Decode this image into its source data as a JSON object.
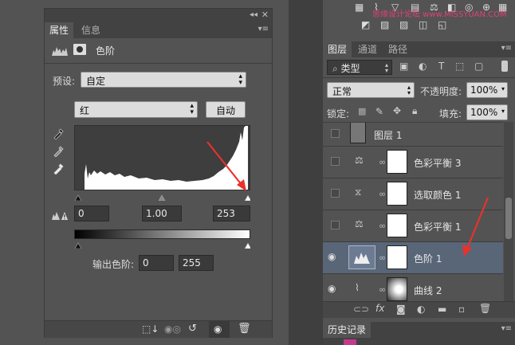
{
  "properties": {
    "tabs": [
      {
        "label": "属性"
      },
      {
        "label": "信息"
      }
    ],
    "adjustment_title": "色阶",
    "preset_label": "预设:",
    "preset_value": "自定",
    "channel_value": "红",
    "auto_label": "自动",
    "input_levels": {
      "black": "0",
      "mid": "1.00",
      "white": "253"
    },
    "output_label": "输出色阶:",
    "output_levels": {
      "black": "0",
      "white": "255"
    }
  },
  "layers_panel": {
    "tabs": [
      {
        "label": "图层"
      },
      {
        "label": "通道"
      },
      {
        "label": "路径"
      }
    ],
    "filter_label": "类型",
    "blend_mode": "正常",
    "opacity_label": "不透明度:",
    "opacity_value": "100%",
    "lock_label": "锁定:",
    "fill_label": "填充:",
    "fill_value": "100%",
    "layers": [
      {
        "name": "图层 1",
        "type": "pixel",
        "visible": false
      },
      {
        "name": "色彩平衡 3",
        "type": "color-balance",
        "visible": false
      },
      {
        "name": "选取颜色 1",
        "type": "selective-color",
        "visible": false
      },
      {
        "name": "色彩平衡 1",
        "type": "color-balance",
        "visible": false
      },
      {
        "name": "色阶 1",
        "type": "levels",
        "visible": true,
        "selected": true
      },
      {
        "name": "曲线 2",
        "type": "curves",
        "visible": true
      }
    ]
  },
  "history_panel": {
    "tab_label": "历史记录"
  },
  "watermark": "思缘设计论坛 www.MISSYUAN.COM",
  "colors": {
    "bg": "#535353",
    "dark": "#3a3a3a",
    "selected": "#596678",
    "arrow": "#e8322b"
  }
}
